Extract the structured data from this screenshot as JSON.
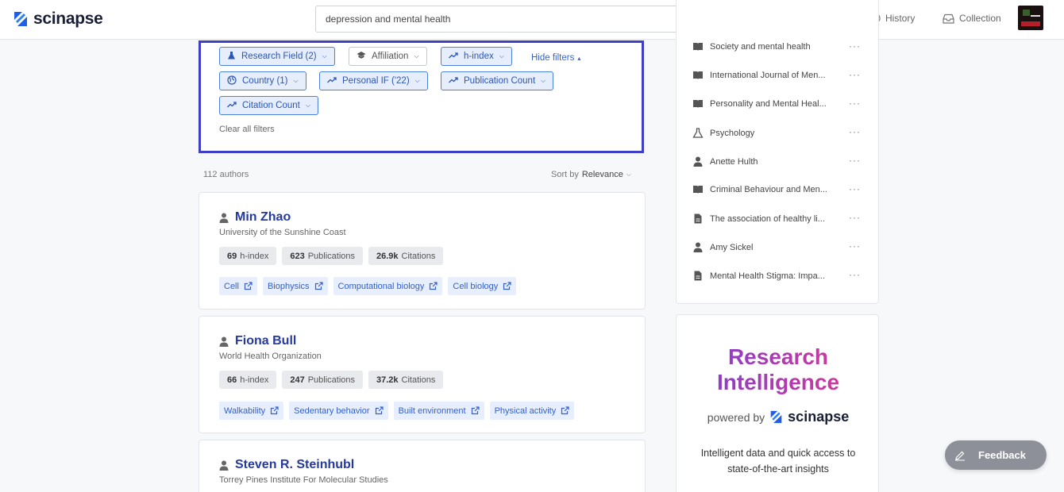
{
  "brand": {
    "name": "scinapse",
    "color": "#1e5ee8"
  },
  "search": {
    "query": "depression and mental health"
  },
  "nav": {
    "history_label": "History",
    "collection_label": "Collection"
  },
  "filters": {
    "chips": [
      {
        "label": "Research Field (2)",
        "icon": "flask-icon",
        "active": true
      },
      {
        "label": "Affiliation",
        "icon": "graduation-cap-icon",
        "active": false
      },
      {
        "label": "h-index",
        "icon": "trending-up-icon",
        "active": true
      },
      {
        "label": "Country (1)",
        "icon": "globe-icon",
        "active": true
      },
      {
        "label": "Personal IF ('22)",
        "icon": "trending-up-icon",
        "active": true
      },
      {
        "label": "Publication Count",
        "icon": "trending-up-icon",
        "active": true
      },
      {
        "label": "Citation Count",
        "icon": "trending-up-icon",
        "active": true
      }
    ],
    "hide_label": "Hide filters",
    "clear_label": "Clear all filters"
  },
  "results": {
    "count_label": "112 authors",
    "sort_prefix": "Sort by",
    "sort_value": "Relevance"
  },
  "authors": [
    {
      "name": "Min Zhao",
      "affiliation": "University of the Sunshine Coast",
      "h_index": "69",
      "h_index_label": "h-index",
      "publications": "623",
      "publications_label": "Publications",
      "citations": "26.9k",
      "citations_label": "Citations",
      "tags": [
        "Cell",
        "Biophysics",
        "Computational biology",
        "Cell biology"
      ]
    },
    {
      "name": "Fiona Bull",
      "affiliation": "World Health Organization",
      "h_index": "66",
      "h_index_label": "h-index",
      "publications": "247",
      "publications_label": "Publications",
      "citations": "37.2k",
      "citations_label": "Citations",
      "tags": [
        "Walkability",
        "Sedentary behavior",
        "Built environment",
        "Physical activity"
      ]
    },
    {
      "name": "Steven R. Steinhubl",
      "affiliation": "Torrey Pines Institute For Molecular Studies"
    }
  ],
  "sidebar": {
    "items": [
      {
        "icon": "book-icon",
        "label": "Society and mental health"
      },
      {
        "icon": "book-icon",
        "label": "International Journal of Men..."
      },
      {
        "icon": "book-icon",
        "label": "Personality and Mental Heal..."
      },
      {
        "icon": "flask-icon",
        "label": "Psychology"
      },
      {
        "icon": "person-icon",
        "label": "Anette Hulth"
      },
      {
        "icon": "book-icon",
        "label": "Criminal Behaviour and Men..."
      },
      {
        "icon": "document-icon",
        "label": "The association of healthy li..."
      },
      {
        "icon": "person-icon",
        "label": "Amy Sickel"
      },
      {
        "icon": "document-icon",
        "label": "Mental Health Stigma: Impa..."
      }
    ],
    "more_label": "···"
  },
  "promo": {
    "title_line1": "Research",
    "title_line2": "Intelligence",
    "powered_by": "powered by",
    "brand": "scinapse",
    "description": "Intelligent data and quick access to state-of-the-art insights"
  },
  "feedback": {
    "label": "Feedback"
  },
  "colors": {
    "accent": "#2d55b3",
    "filter_border": "#3f3fc6",
    "promo_from": "#7a3fd6",
    "promo_to": "#e0378e"
  }
}
